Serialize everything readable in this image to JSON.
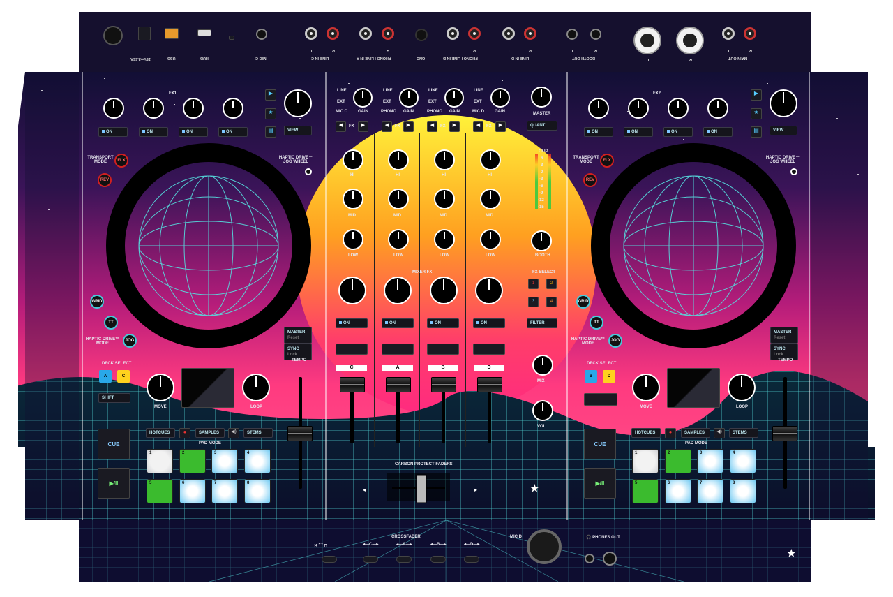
{
  "rear_panel": {
    "labels": [
      "15V⎓2.66A",
      "USB",
      "HUB",
      "MIC C",
      "L",
      "LINE IN C",
      "R",
      "L",
      "PHONO | LINE IN A",
      "R",
      "GND",
      "L",
      "PHONO | LINE IN B",
      "R",
      "L",
      "LINE IN D",
      "R",
      "BOOTH OUT",
      "L",
      "R",
      "L",
      "R",
      "MAIN OUT",
      "L",
      "R"
    ]
  },
  "mixer": {
    "input_select": [
      {
        "a": "LINE",
        "b": "EXT",
        "c": "MIC C",
        "gain": "GAIN"
      },
      {
        "a": "LINE",
        "b": "EXT",
        "c": "PHONO",
        "gain": "GAIN"
      },
      {
        "a": "LINE",
        "b": "EXT",
        "c": "PHONO",
        "gain": "GAIN"
      },
      {
        "a": "LINE",
        "b": "EXT",
        "c": "MIC D",
        "gain": "GAIN"
      }
    ],
    "master_label": "MASTER",
    "quant_label": "QUANT",
    "fx_label": "FX",
    "eq_labels": {
      "hi": "HI",
      "mid": "MID",
      "low": "LOW"
    },
    "booth_label": "BOOTH",
    "mixer_fx_label": "MIXER FX",
    "fx_select_label": "FX SELECT",
    "fx_select_buttons": [
      "1",
      "2",
      "3",
      "4"
    ],
    "on_label": "ON",
    "filter_label": "FILTER",
    "channel_letters": [
      "C",
      "A",
      "B",
      "D"
    ],
    "mic_label": "MIX",
    "vol_label": "VOL",
    "carbon_label": "CARBON PROTECT FADERS",
    "meter_labels": [
      "CLIP",
      "6",
      "3",
      "0",
      "-3",
      "-6",
      "-9",
      "-12",
      "-15"
    ]
  },
  "left_deck": {
    "fx_label": "FX1",
    "on_labels": [
      "ON",
      "ON",
      "ON",
      "ON"
    ],
    "view_label": "VIEW",
    "transport_label": "TRANSPORT MODE",
    "flx_label": "FLX",
    "rev_label": "REV",
    "haptic_label": "HAPTIC DRIVE™ JOG WHEEL",
    "grid_label": "GRID",
    "tt_label": "TT",
    "jog_label": "JOG",
    "haptic_mode_label": "HAPTIC DRIVE™ MODE",
    "master_label": "MASTER",
    "reset_label": "Reset",
    "sync_label": "SYNC",
    "lock_label": "Lock",
    "tempo_label": "TEMPO",
    "deck_select_label": "DECK SELECT",
    "deck_buttons": [
      "A",
      "C"
    ],
    "shift_label": "SHIFT",
    "move_label": "MOVE",
    "loop_label": "LOOP",
    "hotcues_label": "HOTCUES",
    "samples_label": "SAMPLES",
    "stems_label": "STEMS",
    "pad_mode_label": "PAD MODE",
    "cue_label": "CUE",
    "play_label": "▶/II",
    "pads": [
      "1",
      "2",
      "3",
      "4",
      "5",
      "6",
      "7",
      "8"
    ]
  },
  "right_deck": {
    "fx_label": "FX2",
    "on_labels": [
      "ON",
      "ON",
      "ON",
      "ON"
    ],
    "view_label": "VIEW",
    "transport_label": "TRANSPORT MODE",
    "flx_label": "FLX",
    "rev_label": "REV",
    "haptic_label": "HAPTIC DRIVE™ JOG WHEEL",
    "grid_label": "GRID",
    "tt_label": "TT",
    "jog_label": "JOG",
    "haptic_mode_label": "HAPTIC DRIVE™ MODE",
    "master_label": "MASTER",
    "reset_label": "Reset",
    "sync_label": "SYNC",
    "lock_label": "Lock",
    "tempo_label": "TEMPO",
    "deck_select_label": "DECK SELECT",
    "deck_buttons": [
      "B",
      "D"
    ],
    "move_label": "MOVE",
    "loop_label": "LOOP",
    "hotcues_label": "HOTCUES",
    "samples_label": "SAMPLES",
    "stems_label": "STEMS",
    "pad_mode_label": "PAD MODE",
    "cue_label": "CUE",
    "play_label": "▶/II",
    "pads": [
      "1",
      "2",
      "3",
      "4",
      "5",
      "6",
      "7",
      "8"
    ]
  },
  "front_panel": {
    "crossfader_label": "CROSSFADER",
    "curve_labels": [
      "C",
      "A",
      "B",
      "D"
    ],
    "mic_d_label": "MIC D",
    "phones_label": "PHONES OUT"
  },
  "colors": {
    "sky_top": "#1a1240",
    "sun_top": "#ffe93a",
    "sun_bottom": "#ff2d7a",
    "grid": "#56e0e0",
    "deck_a": "#29a8e8",
    "deck_c": "#ffd21e",
    "pad_green": "#3bbb2e"
  }
}
